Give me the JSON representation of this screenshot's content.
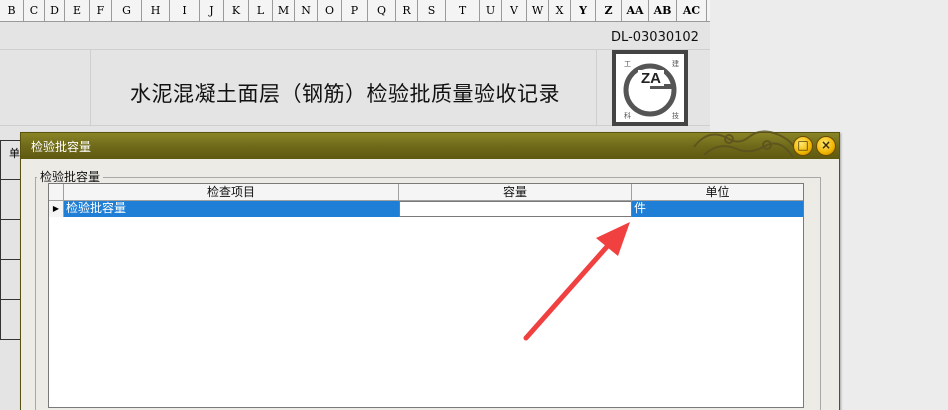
{
  "spreadsheet": {
    "columns": [
      "B",
      "C",
      "D",
      "E",
      "F",
      "G",
      "H",
      "I",
      "J",
      "K",
      "L",
      "M",
      "N",
      "O",
      "P",
      "Q",
      "R",
      "S",
      "T",
      "U",
      "V",
      "W",
      "X",
      "Y",
      "Z",
      "AA",
      "AB",
      "AC"
    ],
    "doc_number": "DL-03030102",
    "title": "水泥混凝土面层（钢筋）检验批质量验收记录",
    "left_cell_text": "单",
    "logo": {
      "text": "ZA",
      "corner_tl": "工",
      "corner_tr": "建",
      "corner_bl": "科",
      "corner_br": "技"
    }
  },
  "dialog": {
    "title": "检验批容量",
    "group_label": "检验批容量",
    "buttons": {
      "minimize": "□",
      "close": "×"
    },
    "grid": {
      "headers": [
        "检查项目",
        "容量",
        "单位"
      ],
      "row_indicator": "▶",
      "rows": [
        {
          "item": "检验批容量",
          "capacity": "",
          "unit": "件"
        }
      ]
    }
  },
  "colors": {
    "titlebar": "#6f6a1a",
    "selection": "#1f7fd6",
    "annotation_arrow": "#f04040"
  }
}
